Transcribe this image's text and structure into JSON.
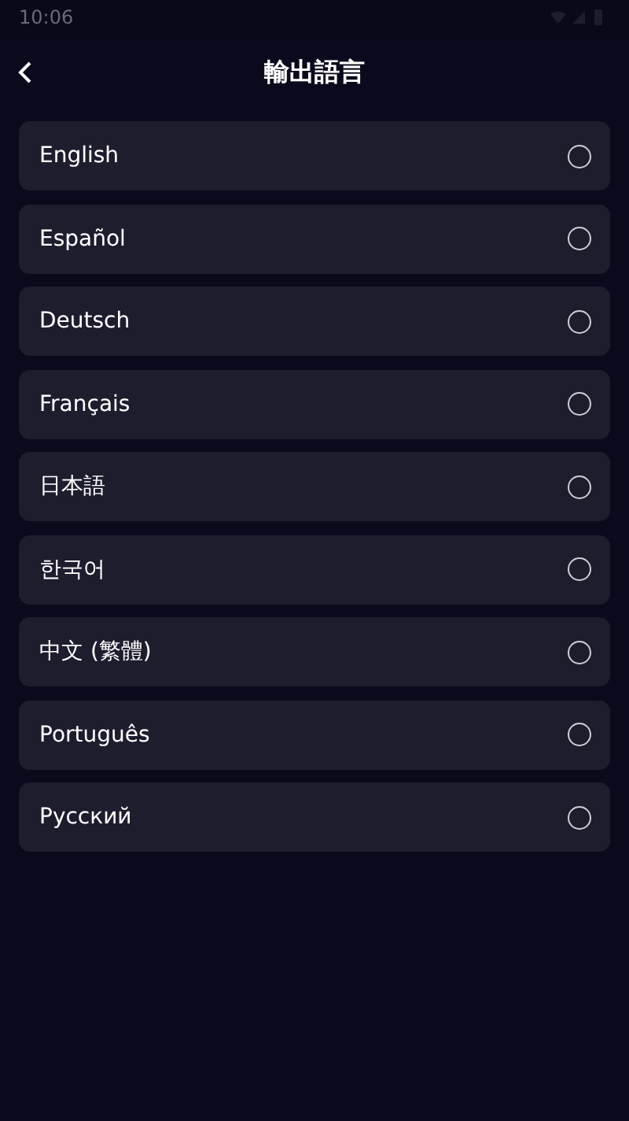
{
  "status_bar": {
    "time": "10:06"
  },
  "header": {
    "title": "輸出語言"
  },
  "languages": [
    {
      "label": "English",
      "selected": false
    },
    {
      "label": "Español",
      "selected": false
    },
    {
      "label": "Deutsch",
      "selected": false
    },
    {
      "label": "Français",
      "selected": false
    },
    {
      "label": "日本語",
      "selected": false
    },
    {
      "label": "한국어",
      "selected": false
    },
    {
      "label": "中文 (繁體)",
      "selected": false
    },
    {
      "label": "Português",
      "selected": false
    },
    {
      "label": "Русский",
      "selected": false
    }
  ]
}
